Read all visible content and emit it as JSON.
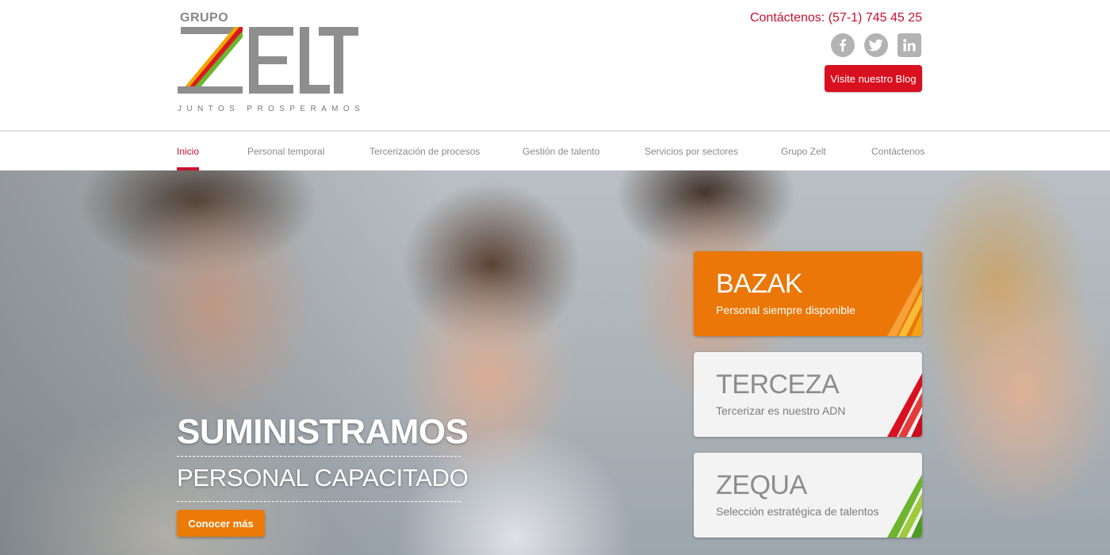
{
  "brand": {
    "group_label": "GRUPO",
    "name": "ZELT",
    "tagline": "JUNTOS PROSPERAMOS"
  },
  "header": {
    "contact_text": "Contáctenos: (57-1) 745 45 25",
    "socials": [
      {
        "name": "facebook",
        "icon": "facebook-icon"
      },
      {
        "name": "twitter",
        "icon": "twitter-icon"
      },
      {
        "name": "linkedin",
        "icon": "linkedin-icon"
      }
    ],
    "blog_button": "Visite nuestro Blog"
  },
  "nav": {
    "items": [
      {
        "label": "Inicio",
        "active": true
      },
      {
        "label": "Personal temporal",
        "active": false
      },
      {
        "label": "Tercerización de procesos",
        "active": false
      },
      {
        "label": "Gestión de talento",
        "active": false
      },
      {
        "label": "Servicios por sectores",
        "active": false
      },
      {
        "label": "Grupo Zelt",
        "active": false
      },
      {
        "label": "Contáctenos",
        "active": false
      }
    ]
  },
  "hero": {
    "title": "SUMINISTRAMOS",
    "subtitle": "PERSONAL CAPACITADO",
    "cta": "Conocer más"
  },
  "cards": [
    {
      "logo": "BAZAK",
      "subtitle": "Personal siempre disponible",
      "color": "#ea7707"
    },
    {
      "logo": "TERCEZA",
      "subtitle": "Tercerizar es nuestro ADN",
      "color": "#d8101f"
    },
    {
      "logo": "ZEQUA",
      "subtitle": "Selección estratégica de talentos",
      "color": "#6cb52d"
    }
  ],
  "colors": {
    "accent_red": "#c8102e",
    "button_red": "#d8101f",
    "orange": "#ec7a06",
    "green": "#6cb52d",
    "logo_gray": "#8e8e8e"
  }
}
